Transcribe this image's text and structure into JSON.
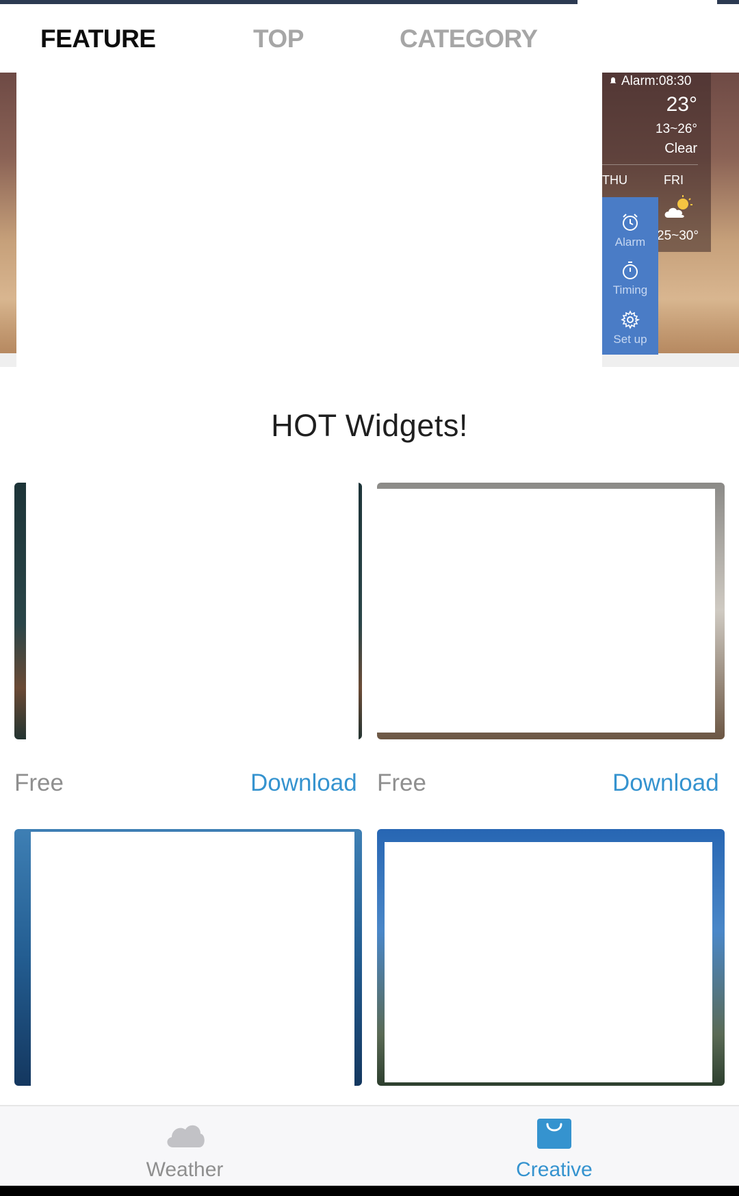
{
  "tabs": [
    {
      "label": "FEATURE",
      "active": true
    },
    {
      "label": "TOP",
      "active": false
    },
    {
      "label": "CATEGORY",
      "active": false
    }
  ],
  "banner": {
    "weather_widget": {
      "alarm": "Alarm:08:30",
      "temperature": "23°",
      "range": "13~26°",
      "condition": "Clear",
      "days": [
        "THU",
        "FRI"
      ],
      "fri_range": "25~30°"
    },
    "side_menu": [
      {
        "label": "Alarm",
        "icon": "alarm-icon"
      },
      {
        "label": "Timing",
        "icon": "timer-icon"
      },
      {
        "label": "Set up",
        "icon": "gear-icon"
      }
    ]
  },
  "section_title": "HOT Widgets!",
  "widgets": [
    {
      "price": "Free",
      "action": "Download"
    },
    {
      "price": "Free",
      "action": "Download"
    }
  ],
  "bottom_nav": [
    {
      "label": "Weather",
      "icon": "cloud-icon",
      "active": false
    },
    {
      "label": "Creative",
      "icon": "shopping-bag-icon",
      "active": true
    }
  ],
  "colors": {
    "accent": "#3593cf",
    "tab_active": "#0d0d0d",
    "tab_inactive": "#a6a6a6",
    "menu_bg": "#4a7cc6"
  }
}
